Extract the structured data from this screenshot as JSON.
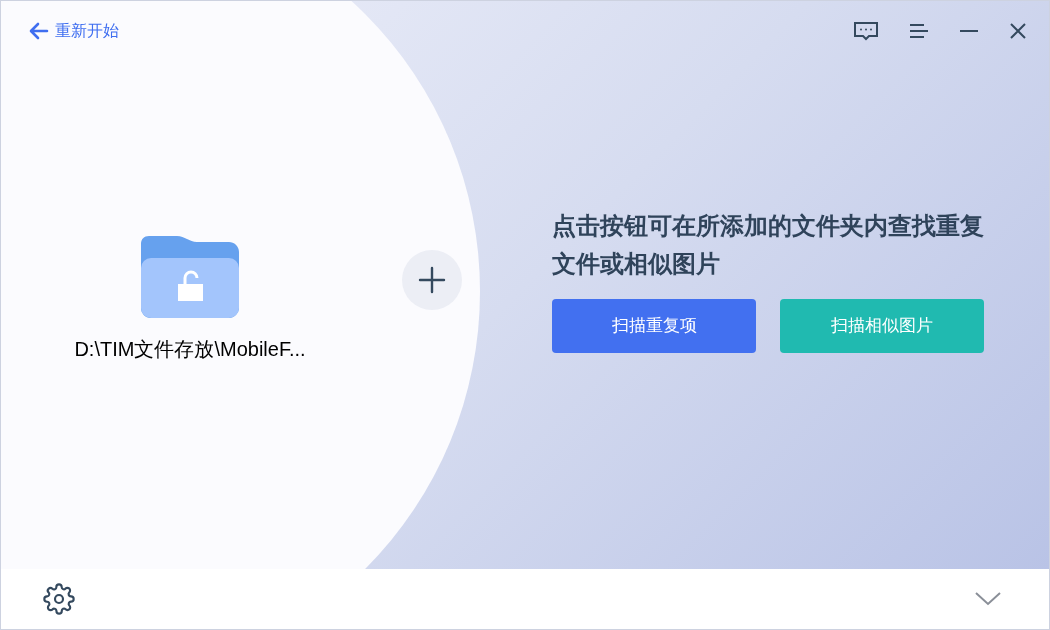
{
  "back_link": {
    "label": "重新开始"
  },
  "folder": {
    "path": "D:\\TIM文件存放\\MobileF..."
  },
  "prompt": {
    "text": "点击按钮可在所添加的文件夹内查找重复文件或相似图片"
  },
  "buttons": [
    {
      "label": "扫描重复项",
      "color": "#4270f0"
    },
    {
      "label": "扫描相似图片",
      "color": "#20bab0"
    }
  ]
}
